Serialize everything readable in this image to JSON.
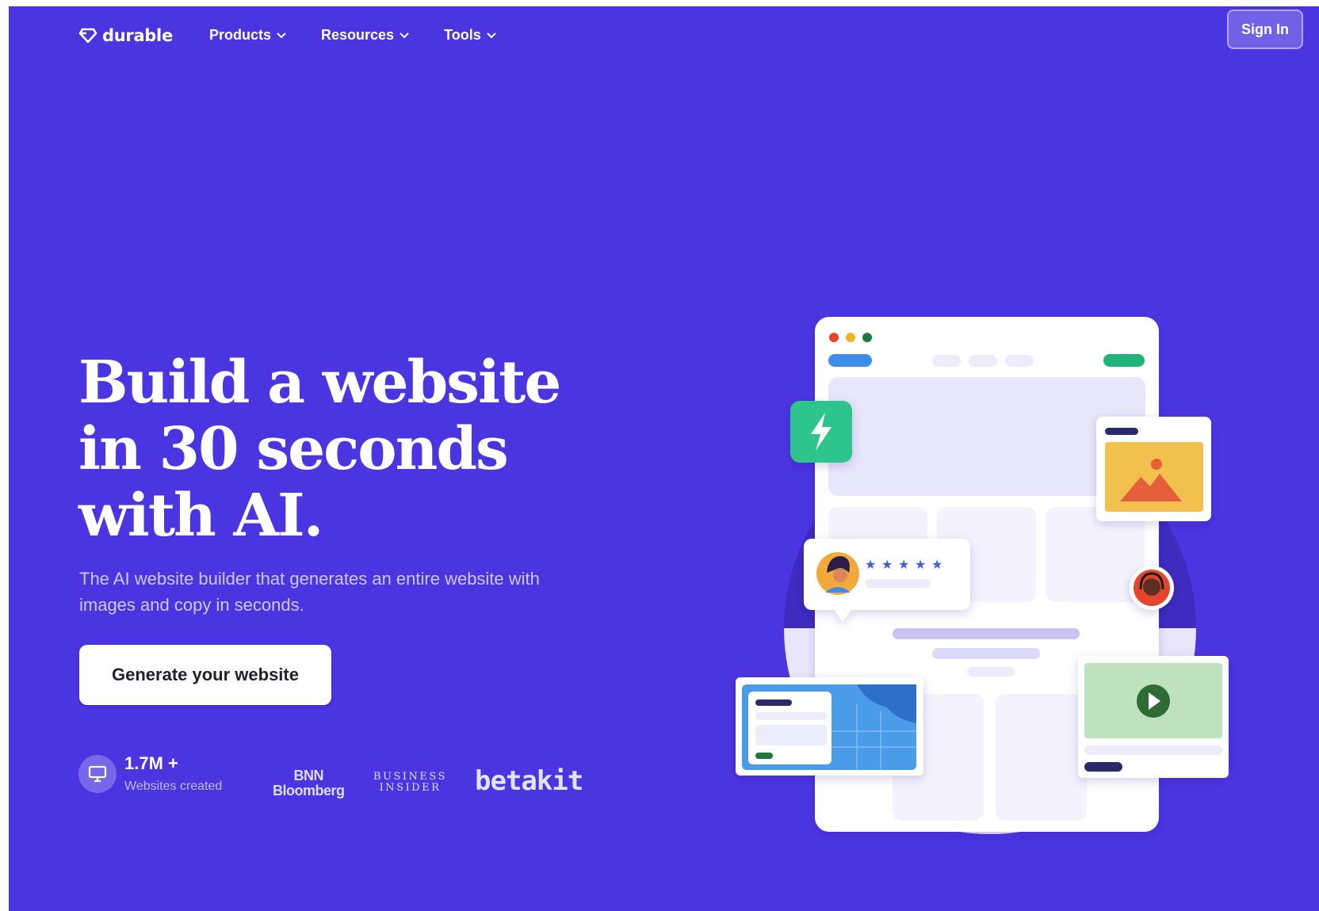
{
  "nav": {
    "logo_text": "durable",
    "menu": [
      {
        "label": "Products"
      },
      {
        "label": "Resources"
      },
      {
        "label": "Tools"
      }
    ],
    "signin_label": "Sign In"
  },
  "hero": {
    "headline": [
      "Build a website",
      "in 30 seconds",
      "with AI."
    ],
    "subhead": "The AI website builder that generates an entire website with images and copy in seconds.",
    "cta_label": "Generate your website"
  },
  "stats": {
    "value": "1.7M +",
    "label": "Websites created"
  },
  "press": {
    "bnn_line1": "BNN",
    "bnn_line2": "Bloomberg",
    "bi_line1": "BUSINESS",
    "bi_line2": "INSIDER",
    "betakit": "betakit"
  },
  "colors": {
    "background": "#4b35e0",
    "accent_green": "#2fc48d",
    "card_bg": "#ffffff",
    "placeholder": "#e8e6fb"
  },
  "icons": {
    "logo": "diamond-icon",
    "bolt": "lightning-icon",
    "image": "image-icon",
    "play": "play-icon",
    "star": "star-icon",
    "monitor": "monitor-icon",
    "chevron": "chevron-down-icon"
  }
}
